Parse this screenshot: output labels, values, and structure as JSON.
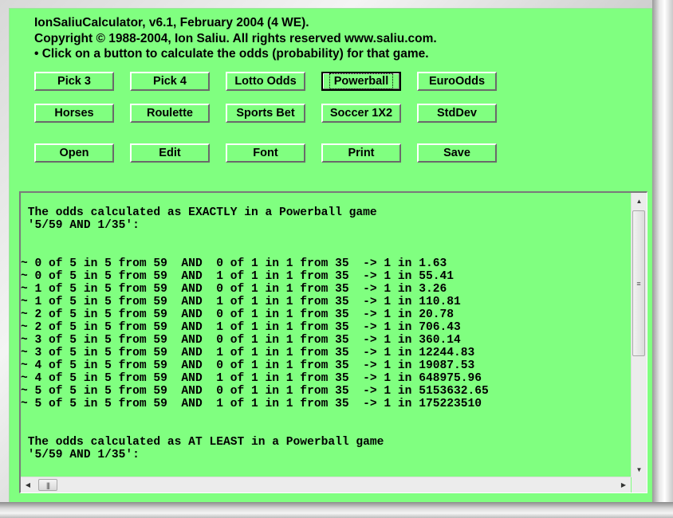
{
  "header": {
    "line1": "IonSaliuCalculator, v6.1, February 2004 (4 WE).",
    "line2": "Copyright © 1988-2004, Ion Saliu. All rights reserved www.saliu.com.",
    "line3": "• Click on a button to calculate the odds (probability) for that game."
  },
  "buttons": {
    "row1": [
      "Pick 3",
      "Pick 4",
      "Lotto Odds",
      "Powerball",
      "EuroOdds"
    ],
    "row2": [
      "Horses",
      "Roulette",
      "Sports Bet",
      "Soccer 1X2",
      "StdDev"
    ],
    "row3": [
      "Open",
      "Edit",
      "Font",
      "Print",
      "Save"
    ],
    "focused": "Powerball"
  },
  "output": {
    "lines": [
      " The odds calculated as EXACTLY in a Powerball game",
      " '5/59 AND 1/35':",
      "",
      "",
      "~ 0 of 5 in 5 from 59  AND  0 of 1 in 1 from 35  -> 1 in 1.63",
      "~ 0 of 5 in 5 from 59  AND  1 of 1 in 1 from 35  -> 1 in 55.41",
      "~ 1 of 5 in 5 from 59  AND  0 of 1 in 1 from 35  -> 1 in 3.26",
      "~ 1 of 5 in 5 from 59  AND  1 of 1 in 1 from 35  -> 1 in 110.81",
      "~ 2 of 5 in 5 from 59  AND  0 of 1 in 1 from 35  -> 1 in 20.78",
      "~ 2 of 5 in 5 from 59  AND  1 of 1 in 1 from 35  -> 1 in 706.43",
      "~ 3 of 5 in 5 from 59  AND  0 of 1 in 1 from 35  -> 1 in 360.14",
      "~ 3 of 5 in 5 from 59  AND  1 of 1 in 1 from 35  -> 1 in 12244.83",
      "~ 4 of 5 in 5 from 59  AND  0 of 1 in 1 from 35  -> 1 in 19087.53",
      "~ 4 of 5 in 5 from 59  AND  1 of 1 in 1 from 35  -> 1 in 648975.96",
      "~ 5 of 5 in 5 from 59  AND  0 of 1 in 1 from 35  -> 1 in 5153632.65",
      "~ 5 of 5 in 5 from 59  AND  1 of 1 in 1 from 35  -> 1 in 175223510",
      "",
      "",
      " The odds calculated as AT LEAST in a Powerball game",
      " '5/59 AND 1/35':"
    ]
  },
  "scrollbars": {
    "up_icon": "▲",
    "down_icon": "▼",
    "left_icon": "◀",
    "right_icon": "▶",
    "v_grip": "≡",
    "h_grip": "|||"
  },
  "colors": {
    "background": "#80ff80"
  }
}
